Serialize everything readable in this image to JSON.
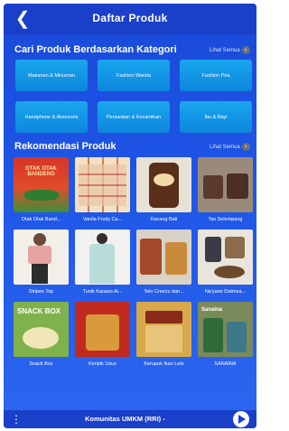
{
  "header": {
    "title": "Daftar Produk",
    "back_icon": "chevron-left-icon"
  },
  "categories_section": {
    "title": "Cari Produk Berdasarkan Kategori",
    "see_all": "Lihat Semua",
    "items": [
      "Makanan & Minuman",
      "Fashion Wanita",
      "Fashion Pria",
      "Handphone & Aksesoris",
      "Perawatan & Kecantikan",
      "Ibu & Bayi"
    ]
  },
  "products_section": {
    "title": "Rekomendasi Produk",
    "see_all": "Lihat Semua",
    "items": [
      {
        "name": "Otak Otak Band...",
        "image_text": "OTAK OTAK BANDENG"
      },
      {
        "name": "Vanila Fruity Ca...",
        "image_text": ""
      },
      {
        "name": "Kacang Bali",
        "image_text": ""
      },
      {
        "name": "Tas Selempang",
        "image_text": ""
      },
      {
        "name": "Stripes Top",
        "image_text": ""
      },
      {
        "name": "Tunik Karawo Ai...",
        "image_text": ""
      },
      {
        "name": "Telo Creezz dan...",
        "image_text": ""
      },
      {
        "name": "Na'yami Oatmea...",
        "image_text": ""
      },
      {
        "name": "Snack Box",
        "image_text": "SNACK BOX"
      },
      {
        "name": "Keripik Usus",
        "image_text": ""
      },
      {
        "name": "Kerupuk Ikan Lele",
        "image_text": ""
      },
      {
        "name": "SANAINA",
        "image_text": "Sanaina"
      }
    ]
  },
  "player": {
    "text": "Komunitas UMKM (RRI) -",
    "menu_icon": "more-vertical-icon",
    "play_icon": "play-icon"
  },
  "colors": {
    "accent": "#1a3fc9",
    "category_tile": "#0e86dc"
  }
}
